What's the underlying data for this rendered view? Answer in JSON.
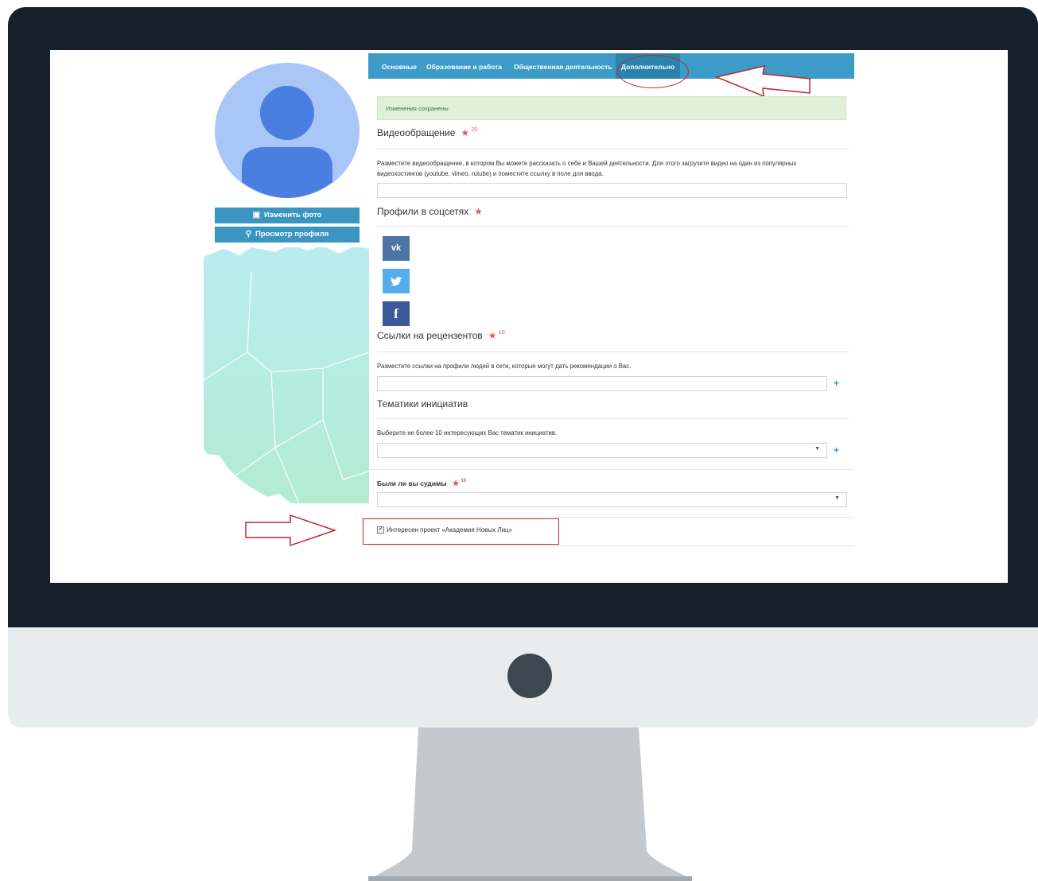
{
  "profile": {
    "change_photo": "Изменить фото",
    "view_profile": "Просмотр профиля",
    "change_photo_icon": "image-icon",
    "view_profile_icon": "search-icon"
  },
  "tabs": {
    "basic": "Основные",
    "education": "Образование и работа",
    "social_activity": "Общественная деятельность",
    "additional": "Дополнительно",
    "active": "additional"
  },
  "alert": {
    "text": "Изменения сохранены"
  },
  "video": {
    "title": "Видеообращение",
    "points": "20",
    "help": "Разместите видеообращение, в котором Вы можете рассказать о себе и Вашей деятельности. Для этого загрузите видео на один из популярных видеохостингов (youtube, vimeo, rutube) и поместите ссылку в поле для ввода.",
    "value": ""
  },
  "social": {
    "title": "Профили в соцсетях",
    "vk": "vk-icon",
    "twitter": "twitter-icon",
    "facebook": "facebook-icon",
    "colors": {
      "vk": "#4c75a3",
      "twitter": "#55acee",
      "facebook": "#3b5998"
    }
  },
  "reviewers": {
    "title": "Ссылки на рецензентов",
    "points": "10",
    "help": "Разместите ссылки на профили людей в сети, которые могут дать рекомендации о Вас.",
    "value": "",
    "add": "+"
  },
  "topics": {
    "title": "Тематики инициатив",
    "help": "Выберите не более 10 интересующих Вас тематик инициатив.",
    "value": "",
    "add": "+"
  },
  "convicted": {
    "title": "Были ли вы судимы",
    "points": "10",
    "value": ""
  },
  "project": {
    "label": "Интересен проект «Академия Новых Лиц»",
    "checked": true
  },
  "colors": {
    "accent": "#3c9bc7",
    "annotation": "#c0272d",
    "bezel": "#15202b",
    "chin": "#e9eced",
    "stand": "#c3c9cd"
  }
}
